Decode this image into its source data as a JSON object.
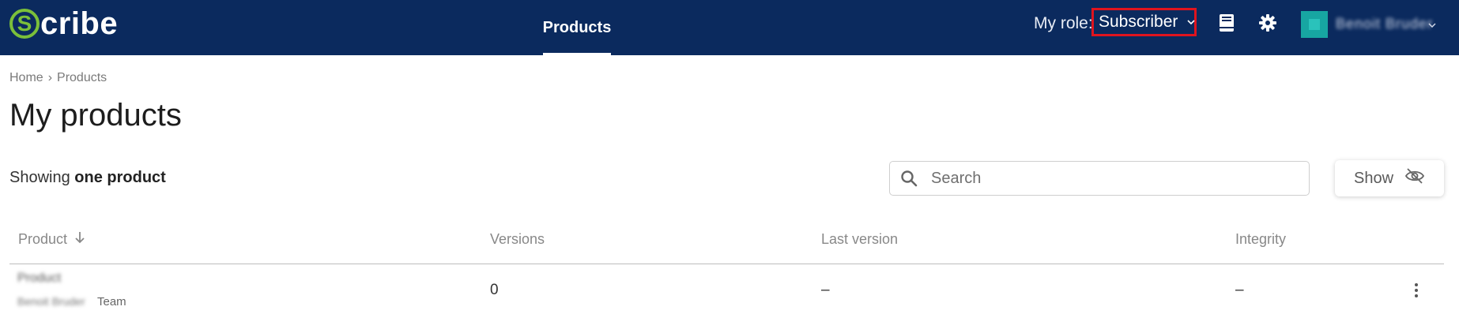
{
  "brand": {
    "logo_letter": "S",
    "logo_rest": "cribe"
  },
  "nav": {
    "active_tab": "Products"
  },
  "header": {
    "role_label": "My role:",
    "role_value": "Subscriber",
    "user_name": "Benoit Bruder",
    "colors": {
      "bar": "#0b2a5e",
      "highlight_border": "#e0141e",
      "avatar": "#17a6a2"
    }
  },
  "breadcrumb": {
    "home": "Home",
    "separator": "›",
    "current": "Products"
  },
  "page": {
    "title": "My products",
    "showing_prefix": "Showing",
    "showing_count": "one product"
  },
  "search": {
    "placeholder": "Search"
  },
  "show_button": {
    "label": "Show"
  },
  "table": {
    "columns": [
      "Product",
      "Versions",
      "Last version",
      "Integrity"
    ],
    "rows": [
      {
        "product_name": "Product",
        "owner": "Benoit Bruder",
        "team": "Team",
        "versions": "0",
        "last_version": "–",
        "integrity": "–"
      }
    ]
  }
}
